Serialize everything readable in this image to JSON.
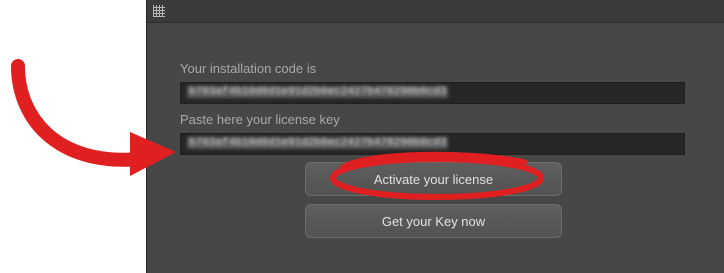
{
  "dialog": {
    "installation_label": "Your installation code is",
    "installation_code": "b703af4b10d6d1e91d2b6ec2427b478290b0cd3",
    "license_label": "Paste here your license key",
    "license_key": "b703af4b10d6d1e91d2b6ec2427b478290b0cd3",
    "activate_button": "Activate your license",
    "get_key_button": "Get your Key now"
  },
  "colors": {
    "annotation": "#e02020",
    "panel": "#474747"
  }
}
